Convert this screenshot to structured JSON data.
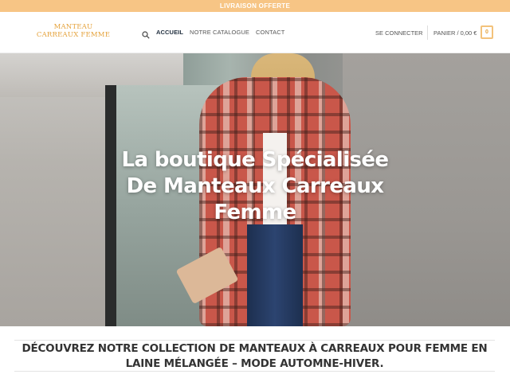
{
  "topbar": {
    "text": "LIVRAISON OFFERTE"
  },
  "header": {
    "logo": {
      "line1": "MANTEAU",
      "line2": "CARREAUX FEMME"
    },
    "nav": [
      {
        "label": "ACCUEIL",
        "active": true
      },
      {
        "label": "NOTRE CATALOGUE",
        "active": false
      },
      {
        "label": "CONTACT",
        "active": false
      }
    ],
    "login_label": "SE CONNECTER",
    "cart_label": "PANIER / 0,00 €",
    "cart_count": "0",
    "accent_color": "#e5a23b"
  },
  "hero": {
    "title_line1": "La boutique Spécialisée",
    "title_line2": "De Manteaux Carreaux",
    "title_line3": "Femme"
  },
  "section": {
    "title_line1": "DÉCOUVREZ NOTRE COLLECTION DE MANTEAUX À CARREAUX POUR FEMME EN",
    "title_line2": "LAINE MÉLANGÉE – MODE AUTOMNE-HIVER."
  },
  "icons": {
    "search": "search-icon"
  }
}
